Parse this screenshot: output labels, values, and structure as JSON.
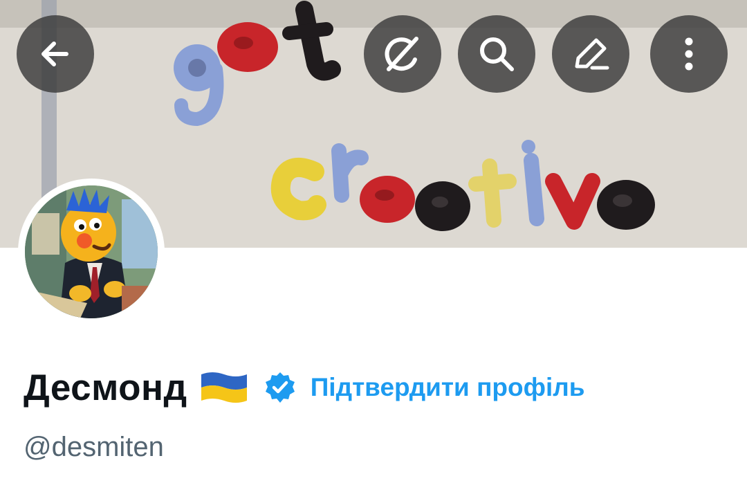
{
  "header": {
    "banner_icon": "plasticine-letters-banner",
    "actions": [
      {
        "name": "back-button",
        "icon": "arrow-left-icon"
      },
      {
        "name": "grok-button",
        "icon": "grok-icon"
      },
      {
        "name": "search-button",
        "icon": "search-icon"
      },
      {
        "name": "edit-button",
        "icon": "pencil-icon"
      },
      {
        "name": "more-button",
        "icon": "more-vertical-icon"
      }
    ]
  },
  "profile": {
    "avatar_icon": "muppet-avatar",
    "display_name": "Десмонд",
    "flag": "flag-ukraine",
    "badge": "verified-badge-icon",
    "verify_link": "Підтвердити профіль",
    "handle": "@desmiten"
  },
  "colors": {
    "accent": "#1d9bf0",
    "text_primary": "#0f1419",
    "text_secondary": "#536471",
    "button_bg": "#3a3a3a",
    "flag_blue": "#2e66c4",
    "flag_yellow": "#f5c518"
  }
}
